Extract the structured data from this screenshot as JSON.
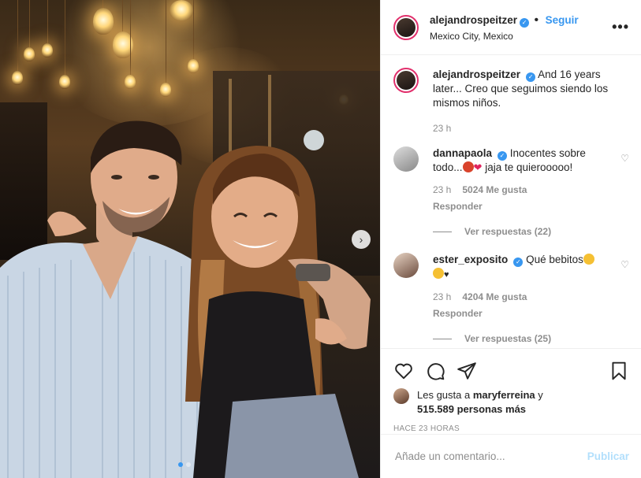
{
  "post": {
    "author": "alejandrospeitzer",
    "location": "Mexico City, Mexico",
    "follow_label": "Seguir",
    "separator": "•",
    "more_label": "•••"
  },
  "caption": {
    "author": "alejandrospeitzer",
    "text": "And 16 years later... Creo que seguimos siendo los mismos niños.",
    "time": "23 h"
  },
  "comments": [
    {
      "author": "dannapaola",
      "text_before": "Inocentes sobre todo...",
      "text_after": " jaja te quierooooo!",
      "time": "23 h",
      "likes": "5024 Me gusta",
      "reply": "Responder",
      "view_replies": "Ver respuestas (22)"
    },
    {
      "author": "ester_exposito",
      "text_before": "Qué bebitos",
      "text_after": "",
      "time": "23 h",
      "likes": "4204 Me gusta",
      "reply": "Responder",
      "view_replies": "Ver respuestas (25)"
    }
  ],
  "likes_summary": {
    "prefix": "Les gusta a",
    "user": "maryferreina",
    "connector": "y",
    "others": "515.589 personas más"
  },
  "time_ago": "HACE 23 HORAS",
  "comment_box": {
    "placeholder": "Añade un comentario...",
    "publish_label": "Publicar"
  },
  "carousel": {
    "total": 2,
    "active": 1
  },
  "colors": {
    "accent": "#3897f0",
    "text": "#262626",
    "muted": "#8e8e8e",
    "publish_disabled": "#b2dffc"
  }
}
